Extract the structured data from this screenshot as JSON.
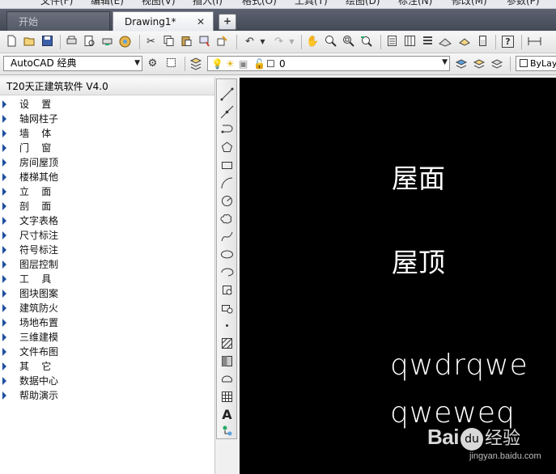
{
  "menubar": {
    "items": [
      "文件(F)",
      "编辑(E)",
      "视图(V)",
      "插入(I)",
      "格式(O)",
      "工具(T)",
      "绘图(D)",
      "标注(N)",
      "修改(M)",
      "参数(P)"
    ]
  },
  "tabs": {
    "start_label": "开始",
    "drawing_label": "Drawing1*",
    "close_glyph": "✕",
    "add_glyph": "+"
  },
  "toolbar1": {
    "icons": [
      "new-icon",
      "open-icon",
      "save-icon",
      "plot-icon",
      "preview-icon",
      "publish-icon",
      "3d-dwf-icon",
      "cut-icon",
      "copy-icon",
      "paste-icon",
      "match-properties-icon",
      "block-editor-icon",
      "undo-icon",
      "redo-icon",
      "pan-icon",
      "zoom-realtime-icon",
      "zoom-window-icon",
      "zoom-previous-icon",
      "properties-icon",
      "design-center-icon",
      "tool-palettes-icon",
      "sheet-set-icon",
      "markup-icon",
      "calculator-icon",
      "help-icon",
      "dimension-icon"
    ]
  },
  "toolbar2": {
    "workspace_value": "AutoCAD 经典",
    "layer_value": "0",
    "color_value": "ByLay"
  },
  "panel": {
    "title": "T20天正建筑软件 V4.0",
    "items": [
      "设    置",
      "轴网柱子",
      "墙    体",
      "门    窗",
      "房间屋顶",
      "楼梯其他",
      "立    面",
      "剖    面",
      "文字表格",
      "尺寸标注",
      "符号标注",
      "图层控制",
      "工    具",
      "图块图案",
      "建筑防火",
      "场地布置",
      "三维建模",
      "文件布图",
      "其    它",
      "数据中心",
      "帮助演示"
    ]
  },
  "drawbar": {
    "icons": [
      "line-icon",
      "construction-line-icon",
      "polyline-icon",
      "polygon-icon",
      "rectangle-icon",
      "arc-icon",
      "circle-icon",
      "revision-cloud-icon",
      "spline-icon",
      "ellipse-icon",
      "ellipse-arc-icon",
      "insert-block-icon",
      "make-block-icon",
      "point-icon",
      "hatch-icon",
      "gradient-icon",
      "region-icon",
      "table-icon",
      "multiline-text-icon",
      "add-selected-icon"
    ],
    "text_tool_glyph": "A"
  },
  "canvas": {
    "texts": [
      "屋面",
      "屋顶",
      "qwdrqwe",
      "qweweq"
    ]
  },
  "watermark": {
    "logo": "Bai",
    "paw": "du",
    "sub": "经验",
    "url": "jingyan.baidu.com"
  },
  "colors": {
    "canvas_bg": "#000000",
    "canvas_text": "#ffffff",
    "tab_bar": "#4c5160",
    "panel_arrow": "#1f4fa0"
  }
}
